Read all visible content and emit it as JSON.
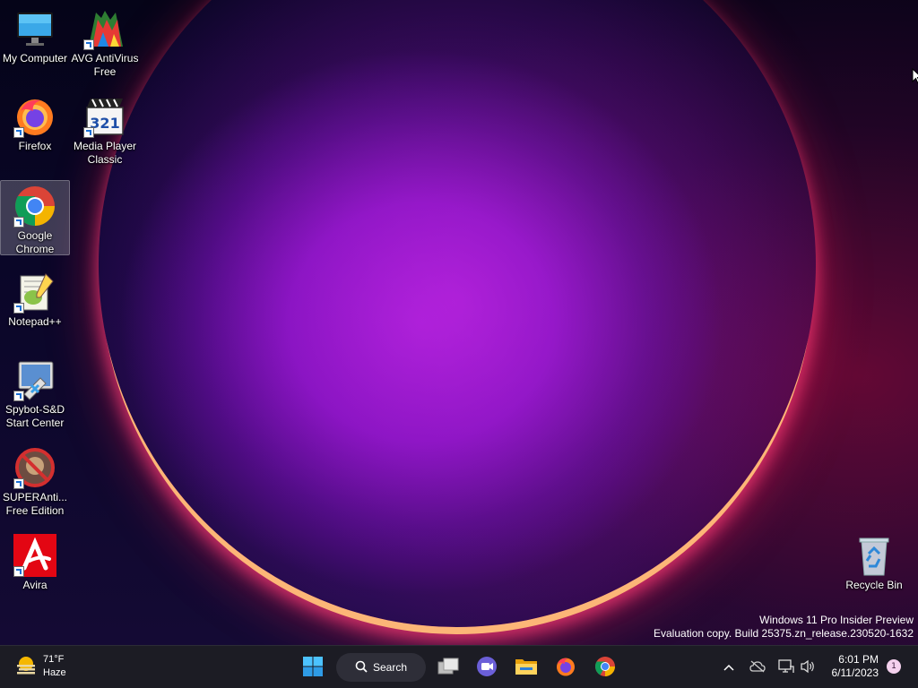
{
  "desktop": {
    "icons": [
      {
        "label": "My Computer",
        "icon": "monitor-icon"
      },
      {
        "label": "AVG AntiVirus\nFree",
        "icon": "avg-icon"
      },
      {
        "label": "Firefox",
        "icon": "firefox-icon"
      },
      {
        "label": "Media Player\nClassic",
        "icon": "media-player-classic-icon"
      },
      {
        "label": "Google\nChrome",
        "icon": "chrome-icon"
      },
      {
        "label": "Notepad++",
        "icon": "notepad-plus-plus-icon"
      },
      {
        "label": "Spybot-S&D\nStart Center",
        "icon": "spybot-icon"
      },
      {
        "label": "SUPERAnti...\nFree Edition",
        "icon": "superantispyware-icon"
      },
      {
        "label": "Avira",
        "icon": "avira-icon"
      },
      {
        "label": "Recycle Bin",
        "icon": "recycle-bin-icon"
      }
    ],
    "watermark": {
      "line1": "Windows 11 Pro Insider Preview",
      "line2": "Evaluation copy. Build 25375.zn_release.230520-1632"
    }
  },
  "taskbar": {
    "weather": {
      "temp": "71°F",
      "condition": "Haze"
    },
    "search_label": "Search",
    "pinned": [
      "start-icon",
      "task-view-icon",
      "chat-icon",
      "file-explorer-icon",
      "firefox-icon",
      "chrome-icon"
    ],
    "tray": {
      "time": "6:01 PM",
      "date": "6/11/2023",
      "notifications": "1"
    }
  },
  "colors": {
    "taskbar_bg": "#1c1c24",
    "accent": "#3b8ee8"
  }
}
